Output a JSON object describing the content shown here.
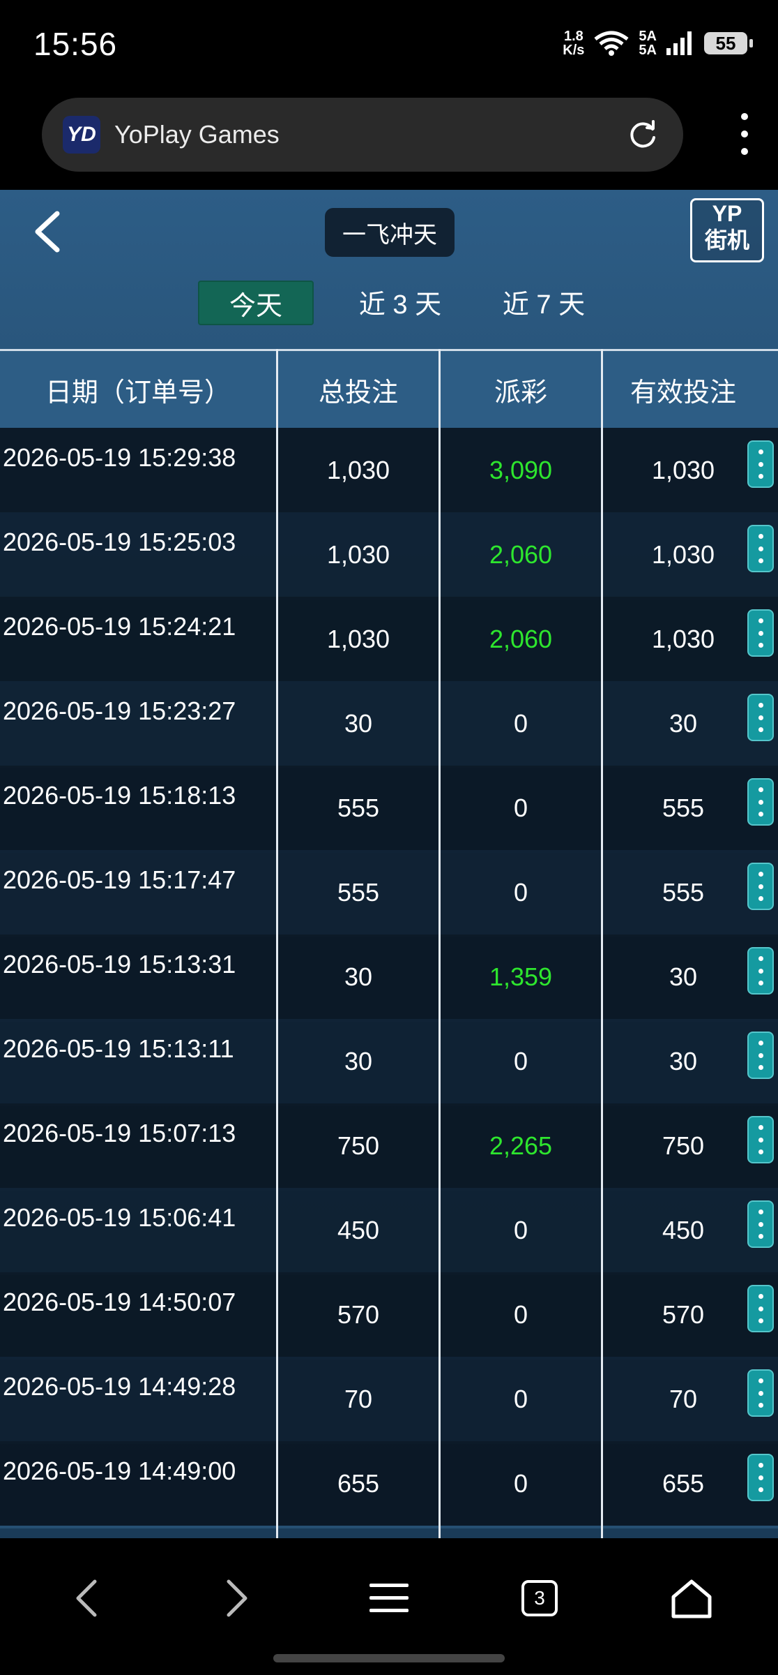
{
  "status_bar": {
    "time": "15:56",
    "net_speed_value": "1.8",
    "net_speed_unit": "K/s",
    "signal_label": "5A",
    "battery": "55"
  },
  "browser": {
    "site_logo": "YD",
    "title": "YoPlay Games"
  },
  "game": {
    "title": "一飞冲天",
    "logo_line1": "YP",
    "logo_line2": "街机",
    "tabs": [
      "今天",
      "近 3 天",
      "近 7 天"
    ],
    "active_tab": 0,
    "columns": [
      "日期（订单号）",
      "总投注",
      "派彩",
      "有效投注"
    ],
    "rows": [
      {
        "date": "2026-05-19 15:29:38",
        "bet": "1,030",
        "payout": "3,090",
        "valid": "1,030",
        "win": true
      },
      {
        "date": "2026-05-19 15:25:03",
        "bet": "1,030",
        "payout": "2,060",
        "valid": "1,030",
        "win": true
      },
      {
        "date": "2026-05-19 15:24:21",
        "bet": "1,030",
        "payout": "2,060",
        "valid": "1,030",
        "win": true
      },
      {
        "date": "2026-05-19 15:23:27",
        "bet": "30",
        "payout": "0",
        "valid": "30",
        "win": false
      },
      {
        "date": "2026-05-19 15:18:13",
        "bet": "555",
        "payout": "0",
        "valid": "555",
        "win": false
      },
      {
        "date": "2026-05-19 15:17:47",
        "bet": "555",
        "payout": "0",
        "valid": "555",
        "win": false
      },
      {
        "date": "2026-05-19 15:13:31",
        "bet": "30",
        "payout": "1,359",
        "valid": "30",
        "win": true
      },
      {
        "date": "2026-05-19 15:13:11",
        "bet": "30",
        "payout": "0",
        "valid": "30",
        "win": false
      },
      {
        "date": "2026-05-19 15:07:13",
        "bet": "750",
        "payout": "2,265",
        "valid": "750",
        "win": true
      },
      {
        "date": "2026-05-19 15:06:41",
        "bet": "450",
        "payout": "0",
        "valid": "450",
        "win": false
      },
      {
        "date": "2026-05-19 14:50:07",
        "bet": "570",
        "payout": "0",
        "valid": "570",
        "win": false
      },
      {
        "date": "2026-05-19 14:49:28",
        "bet": "70",
        "payout": "0",
        "valid": "70",
        "win": false
      },
      {
        "date": "2026-05-19 14:49:00",
        "bet": "655",
        "payout": "0",
        "valid": "655",
        "win": false
      }
    ],
    "colors": {
      "win": "#2ee62e",
      "active_tab": "#136655",
      "more_button": "#159aa0"
    }
  },
  "nav": {
    "tab_count": "3"
  },
  "icons": {
    "back": "chevron-left-icon",
    "reload": "reload-icon",
    "menu": "more-vertical-icon",
    "row_menu": "more-vertical-icon",
    "nav_back": "arrow-left-icon",
    "nav_forward": "arrow-right-icon",
    "nav_menu": "hamburger-icon",
    "nav_home": "home-icon"
  }
}
